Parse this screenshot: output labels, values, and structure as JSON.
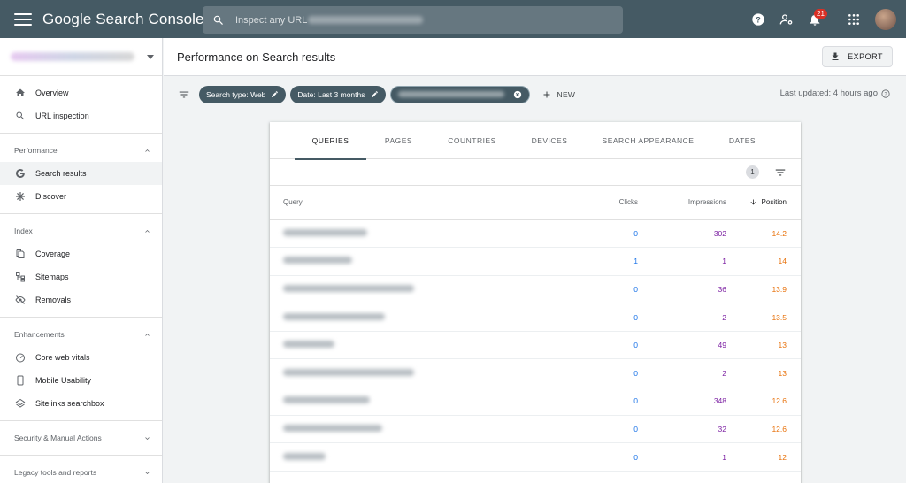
{
  "app": {
    "title": "Google Search Console",
    "search_placeholder": "Inspect any URL in"
  },
  "topbar": {
    "notification_count": "21",
    "icons": [
      "help-icon",
      "manage-users-icon",
      "notifications-icon",
      "apps-grid-icon"
    ]
  },
  "sidebar": {
    "top_items": [
      {
        "label": "Overview",
        "icon": "home-icon"
      },
      {
        "label": "URL inspection",
        "icon": "search-icon"
      }
    ],
    "sections": [
      {
        "title": "Performance",
        "expanded": true,
        "items": [
          {
            "label": "Search results",
            "icon": "google-g-icon",
            "active": true
          },
          {
            "label": "Discover",
            "icon": "asterisk-icon"
          }
        ]
      },
      {
        "title": "Index",
        "expanded": true,
        "items": [
          {
            "label": "Coverage",
            "icon": "copy-icon"
          },
          {
            "label": "Sitemaps",
            "icon": "sitemap-icon"
          },
          {
            "label": "Removals",
            "icon": "eye-off-icon"
          }
        ]
      },
      {
        "title": "Enhancements",
        "expanded": true,
        "items": [
          {
            "label": "Core web vitals",
            "icon": "speedometer-icon"
          },
          {
            "label": "Mobile Usability",
            "icon": "phone-icon"
          },
          {
            "label": "Sitelinks searchbox",
            "icon": "layers-icon"
          }
        ]
      },
      {
        "title": "Security & Manual Actions",
        "expanded": false,
        "items": []
      },
      {
        "title": "Legacy tools and reports",
        "expanded": false,
        "items": []
      }
    ]
  },
  "header": {
    "title": "Performance on Search results",
    "export_label": "EXPORT"
  },
  "filters": {
    "chips": [
      "Search type: Web",
      "Date: Last 3 months"
    ],
    "new_label": "NEW",
    "last_updated": "Last updated: 4 hours ago"
  },
  "tabs": [
    "QUERIES",
    "PAGES",
    "COUNTRIES",
    "DEVICES",
    "SEARCH APPEARANCE",
    "DATES"
  ],
  "active_tab": "QUERIES",
  "active_filter_count": "1",
  "table": {
    "columns": [
      "Query",
      "Clicks",
      "Impressions",
      "Position"
    ],
    "sort_column": "Position",
    "rows": [
      {
        "clicks": "0",
        "impressions": "302",
        "position": "14.2"
      },
      {
        "clicks": "1",
        "impressions": "1",
        "position": "14"
      },
      {
        "clicks": "0",
        "impressions": "36",
        "position": "13.9"
      },
      {
        "clicks": "0",
        "impressions": "2",
        "position": "13.5"
      },
      {
        "clicks": "0",
        "impressions": "49",
        "position": "13"
      },
      {
        "clicks": "0",
        "impressions": "2",
        "position": "13"
      },
      {
        "clicks": "0",
        "impressions": "348",
        "position": "12.6"
      },
      {
        "clicks": "0",
        "impressions": "32",
        "position": "12.6"
      },
      {
        "clicks": "0",
        "impressions": "1",
        "position": "12"
      }
    ]
  },
  "colors": {
    "topbar": "#455a64",
    "clicks": "#1a73e8",
    "impressions": "#7b1fa2",
    "position": "#e8710a"
  }
}
